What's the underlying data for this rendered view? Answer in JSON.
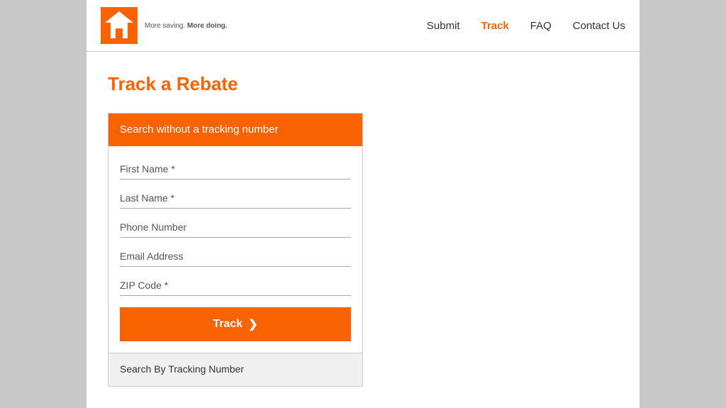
{
  "header": {
    "logo_tagline_part1": "More saving.",
    "logo_tagline_part2": "More doing.",
    "nav": {
      "submit": "Submit",
      "track": "Track",
      "faq": "FAQ",
      "contact": "Contact Us"
    }
  },
  "main": {
    "page_title": "Track a Rebate",
    "form": {
      "section_header": "Search without a tracking number",
      "fields": {
        "first_name_placeholder": "First Name *",
        "last_name_placeholder": "Last Name *",
        "phone_placeholder": "Phone Number",
        "email_placeholder": "Email Address",
        "zip_placeholder": "ZIP Code *"
      },
      "track_button": "Track",
      "track_button_arrow": "❯",
      "tracking_number_section": "Search By Tracking Number"
    }
  }
}
